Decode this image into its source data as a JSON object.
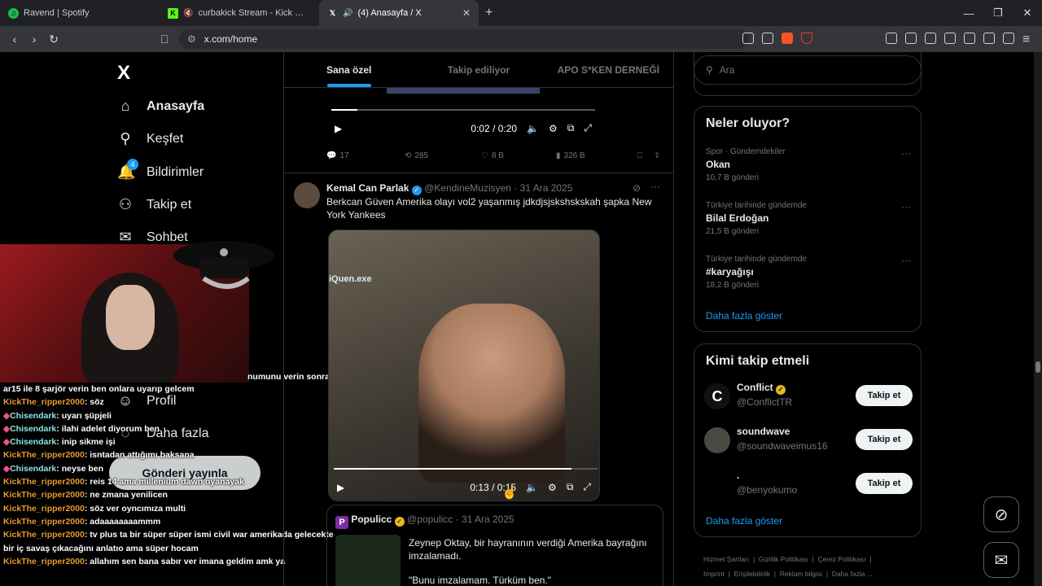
{
  "browser": {
    "tabs": [
      {
        "title": "Ravend | Spotify",
        "icon": "spotify-icon"
      },
      {
        "title": "curbakick Stream - Kick Dashboard",
        "icon": "kick-icon"
      },
      {
        "title": "(4) Anasayfa / X",
        "icon": "x-icon"
      }
    ],
    "url": "x.com/home"
  },
  "nav": {
    "logo": "X",
    "items": [
      {
        "label": "Anasayfa",
        "icon": "home-icon"
      },
      {
        "label": "Keşfet",
        "icon": "search-icon"
      },
      {
        "label": "Bildirimler",
        "icon": "bell-icon",
        "badge": "4"
      },
      {
        "label": "Takip et",
        "icon": "person-add-icon"
      },
      {
        "label": "Sohbet",
        "icon": "mail-icon"
      },
      {
        "label": "Profil",
        "icon": "profile-icon"
      },
      {
        "label": "Daha fazla",
        "icon": "more-icon"
      }
    ],
    "post_button": "Gönderi yayınla"
  },
  "overlay": {
    "top_text": "numunu verin sonra",
    "chat": [
      {
        "user": "",
        "msg": "ar15 ile 8 şarjör verin ben onlara uyarıp gelcem",
        "cls": ""
      },
      {
        "user": "KickThe_ripper2000",
        "msg": "söz",
        "cls": "u1"
      },
      {
        "user": "Chisendark",
        "msg": "uyarı şüpjeli",
        "cls": "u2"
      },
      {
        "user": "Chisendark",
        "msg": "ilahi adelet diyorum ben",
        "cls": "u2"
      },
      {
        "user": "Chisendark",
        "msg": "inip sikme işi",
        "cls": "u2"
      },
      {
        "user": "KickThe_ripper2000",
        "msg": "isntadan attığımı baksana",
        "cls": "u1"
      },
      {
        "user": "Chisendark",
        "msg": "neyse ben",
        "cls": "u2"
      },
      {
        "user": "KickThe_ripper2000",
        "msg": "reis 14 ama millenium dawn oyanayak",
        "cls": "u1"
      },
      {
        "user": "KickThe_ripper2000",
        "msg": "ne zmana yenilicen",
        "cls": "u1"
      },
      {
        "user": "KickThe_ripper2000",
        "msg": "söz ver oyncımıza multi",
        "cls": "u1"
      },
      {
        "user": "KickThe_ripper2000",
        "msg": "adaaaaaaaammm",
        "cls": "u1"
      },
      {
        "user": "KickThe_ripper2000",
        "msg": "tv plus ta bir süper süper ismi civil war amerikada gelecekte bir iç savaş çıkacağını anlatıo ama süper hocam",
        "cls": "u1"
      },
      {
        "user": "KickThe_ripper2000",
        "msg": "allahım sen bana sabır ver imana geldim amk ya",
        "cls": "u1"
      }
    ]
  },
  "timeline": {
    "tabs": [
      "Sana özel",
      "Takip ediliyor",
      "APO S*KEN DERNEĞİ"
    ],
    "video1": {
      "time": "0:02 / 0:20",
      "progress": 0.1
    },
    "actions": {
      "replies": "17",
      "reposts": "285",
      "likes": "8 B",
      "views": "326 B"
    },
    "tweet": {
      "name": "Kemal Can Parlak",
      "handle": "@KendineMuzisyen",
      "date": "31 Ara 2025",
      "text": "Berkcan Güven Amerika olayı vol2 yaşanmış jdkdjsjskshskskah şapka New York Yankees",
      "video_label": "iQuen.exe",
      "video_time": "0:13 / 0:15",
      "progress": 0.9
    },
    "quote": {
      "name": "Populicc",
      "handle": "@populicc",
      "date": "31 Ara 2025",
      "text": "Zeynep Oktay, bir hayranının verdiği Amerika bayrağını imzalamadı.",
      "quote": "\"Bunu imzalamam. Türküm ben.\""
    }
  },
  "sidebar": {
    "search_placeholder": "Ara",
    "trends_title": "Neler oluyor?",
    "trends": [
      {
        "context": "Spor · Gündemdekiler",
        "name": "Okan",
        "posts": "10,7 B gönderi"
      },
      {
        "context": "Türkiye tarihinde gündemde",
        "name": "Bilal Erdoğan",
        "posts": "21,5 B gönderi"
      },
      {
        "context": "Türkiye tarihinde gündemde",
        "name": "#karyağışı",
        "posts": "18,2 B gönderi"
      }
    ],
    "show_more": "Daha fazla göster",
    "who_title": "Kimi takip etmeli",
    "who": [
      {
        "name": "Conflict",
        "handle": "@ConflictTR",
        "color": "#1a1a1a"
      },
      {
        "name": "soundwave",
        "handle": "@soundwaveimus16",
        "color": "#3c3c3c"
      },
      {
        "name": ".",
        "handle": "@benyokumo",
        "color": "#000000"
      }
    ],
    "follow": "Takip et",
    "footer": [
      "Hizmet Şartları",
      "Gizlilik Politikası",
      "Çerez Politikası",
      "Imprint",
      "Erişilebilirlik",
      "Reklam bilgisi",
      "Daha fazla ..."
    ]
  }
}
